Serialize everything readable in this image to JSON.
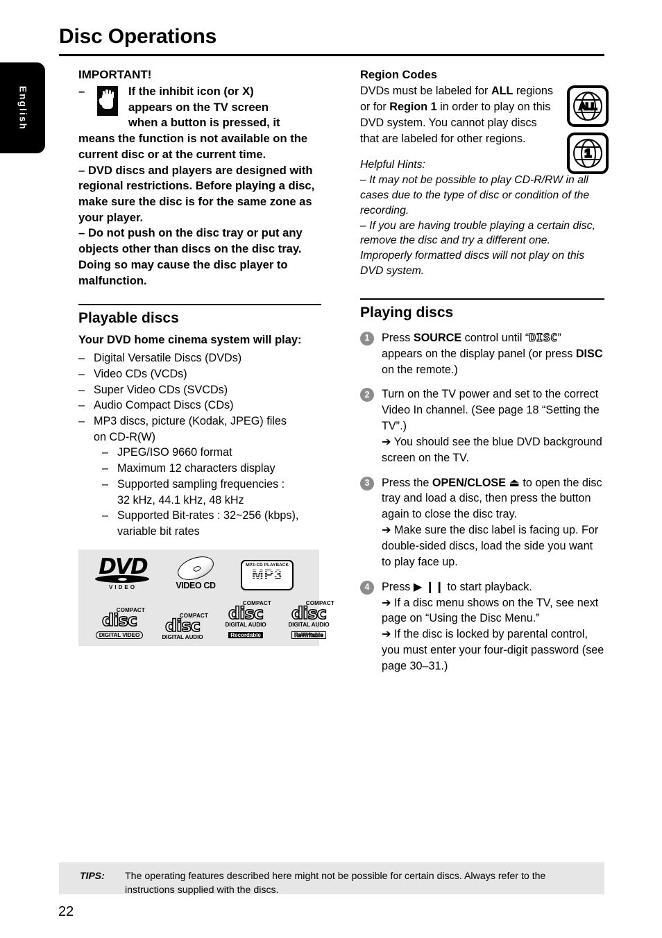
{
  "page": {
    "title": "Disc Operations",
    "language_tab": "English",
    "page_number": "22"
  },
  "left_column": {
    "important": {
      "label": "IMPORTANT!",
      "dash": "–",
      "hand_icon": "inhibit-hand-icon",
      "first_bullet_line1": "If the inhibit icon (or X)",
      "first_bullet_line2": "appears on the TV screen",
      "first_bullet_line3": "when a button is pressed, it",
      "first_bullet_rest": "means the function is not available on the current disc or at the current time.",
      "bullet2": "– DVD discs and players are designed with regional restrictions. Before playing a disc, make sure the disc is for the same zone as your player.",
      "bullet3": "– Do not push on the disc tray or put any objects other than discs on the disc tray.  Doing so may cause the disc player to malfunction."
    },
    "playable_discs": {
      "heading": "Playable discs",
      "subheading": "Your DVD home cinema system will play:",
      "items": [
        {
          "dash": "–",
          "text": "Digital Versatile Discs (DVDs)"
        },
        {
          "dash": "–",
          "text": "Video CDs (VCDs)"
        },
        {
          "dash": "–",
          "text": "Super Video CDs (SVCDs)"
        },
        {
          "dash": "–",
          "text": "Audio Compact Discs (CDs)"
        },
        {
          "dash": "–",
          "text": "MP3 discs, picture (Kodak, JPEG) files"
        }
      ],
      "mp3_continuation": "on CD-R(W)",
      "sub_items": [
        {
          "dash": "–",
          "text": "JPEG/ISO 9660 format"
        },
        {
          "dash": "–",
          "text": "Maximum 12 characters display"
        },
        {
          "dash": "–",
          "text": "Supported sampling frequencies :"
        }
      ],
      "sub_cont_1": "32 kHz, 44.1 kHz, 48 kHz",
      "sub_item_4": {
        "dash": "–",
        "text": "Supported Bit-rates : 32~256 (kbps),"
      },
      "sub_cont_2": "variable bit rates"
    },
    "disc_logos": [
      {
        "name": "dvd-video-logo",
        "main": "DVD",
        "sub": "VIDEO"
      },
      {
        "name": "video-cd-logo",
        "sub": "VIDEO CD"
      },
      {
        "name": "mp3-cd-playback-logo",
        "top": "MP3-CD PLAYBACK",
        "main": "MP3"
      },
      {
        "name": "cd-digital-video-logo",
        "top": "COMPACT",
        "main": "disc",
        "sub": "DIGITAL VIDEO"
      },
      {
        "name": "cd-digital-audio-logo",
        "top": "COMPACT",
        "main": "disc",
        "sub": "DIGITAL AUDIO"
      },
      {
        "name": "cd-recordable-logo",
        "top": "COMPACT",
        "main": "disc",
        "sub": "DIGITAL AUDIO",
        "sub2": "Recordable"
      },
      {
        "name": "cd-rewritable-logo",
        "top": "COMPACT",
        "main": "disc",
        "sub": "DIGITAL AUDIO",
        "sub2": "ReWritable"
      }
    ]
  },
  "right_column": {
    "region_codes": {
      "heading": "Region Codes",
      "body_1": "DVDs must be labeled for ",
      "body_all": "ALL",
      "body_2": " regions or for ",
      "body_region1": "Region 1",
      "body_3": " in order to play on this DVD system. You cannot play discs that are labeled for other regions.",
      "icon_all_label": "ALL",
      "icon_one_label": "1"
    },
    "helpful_hints": {
      "title": "Helpful Hints:",
      "hint_1": "–  It may not be possible to play CD-R/RW in all cases due to the type of disc or condition of the recording.",
      "hint_2": "–  If you are having trouble playing a certain disc, remove the disc and try a different one. Improperly formatted discs will not play on this DVD system."
    },
    "playing_discs": {
      "heading": "Playing discs",
      "steps": [
        {
          "num": "1",
          "pre": "Press ",
          "bold": "SOURCE",
          "mid": " control until “",
          "lcd": "DISC",
          "post": "” appears on the display panel (or press ",
          "bold2": "DISC",
          "tail": " on the remote.)"
        },
        {
          "num": "2",
          "text": "Turn on the TV power and set to the correct Video In channel.  (See page 18 “Setting the TV”.)",
          "arrow_notes": [
            "➔ You should see the blue DVD background screen on the TV."
          ]
        },
        {
          "num": "3",
          "pre": "Press the ",
          "bold": "OPEN/CLOSE ⏏",
          "post": " to open the disc tray and load a disc, then press the button again to close the disc tray.",
          "arrow_notes": [
            "➔ Make sure the disc label is facing up. For double-sided discs, load the side you want to play face up."
          ]
        },
        {
          "num": "4",
          "pre": "Press  ",
          "bold": "▶ ❙❙",
          "post": "  to start playback.",
          "arrow_notes": [
            "➔ If a disc menu shows on the TV, see next page on “Using the Disc Menu.”",
            "➔ If the disc is locked by parental control, you must enter your four-digit password (see page 30–31.)"
          ]
        }
      ]
    }
  },
  "tips": {
    "label": "TIPS:",
    "text": "The operating features described here might not be possible for certain discs.  Always refer to the instructions supplied with the discs."
  }
}
